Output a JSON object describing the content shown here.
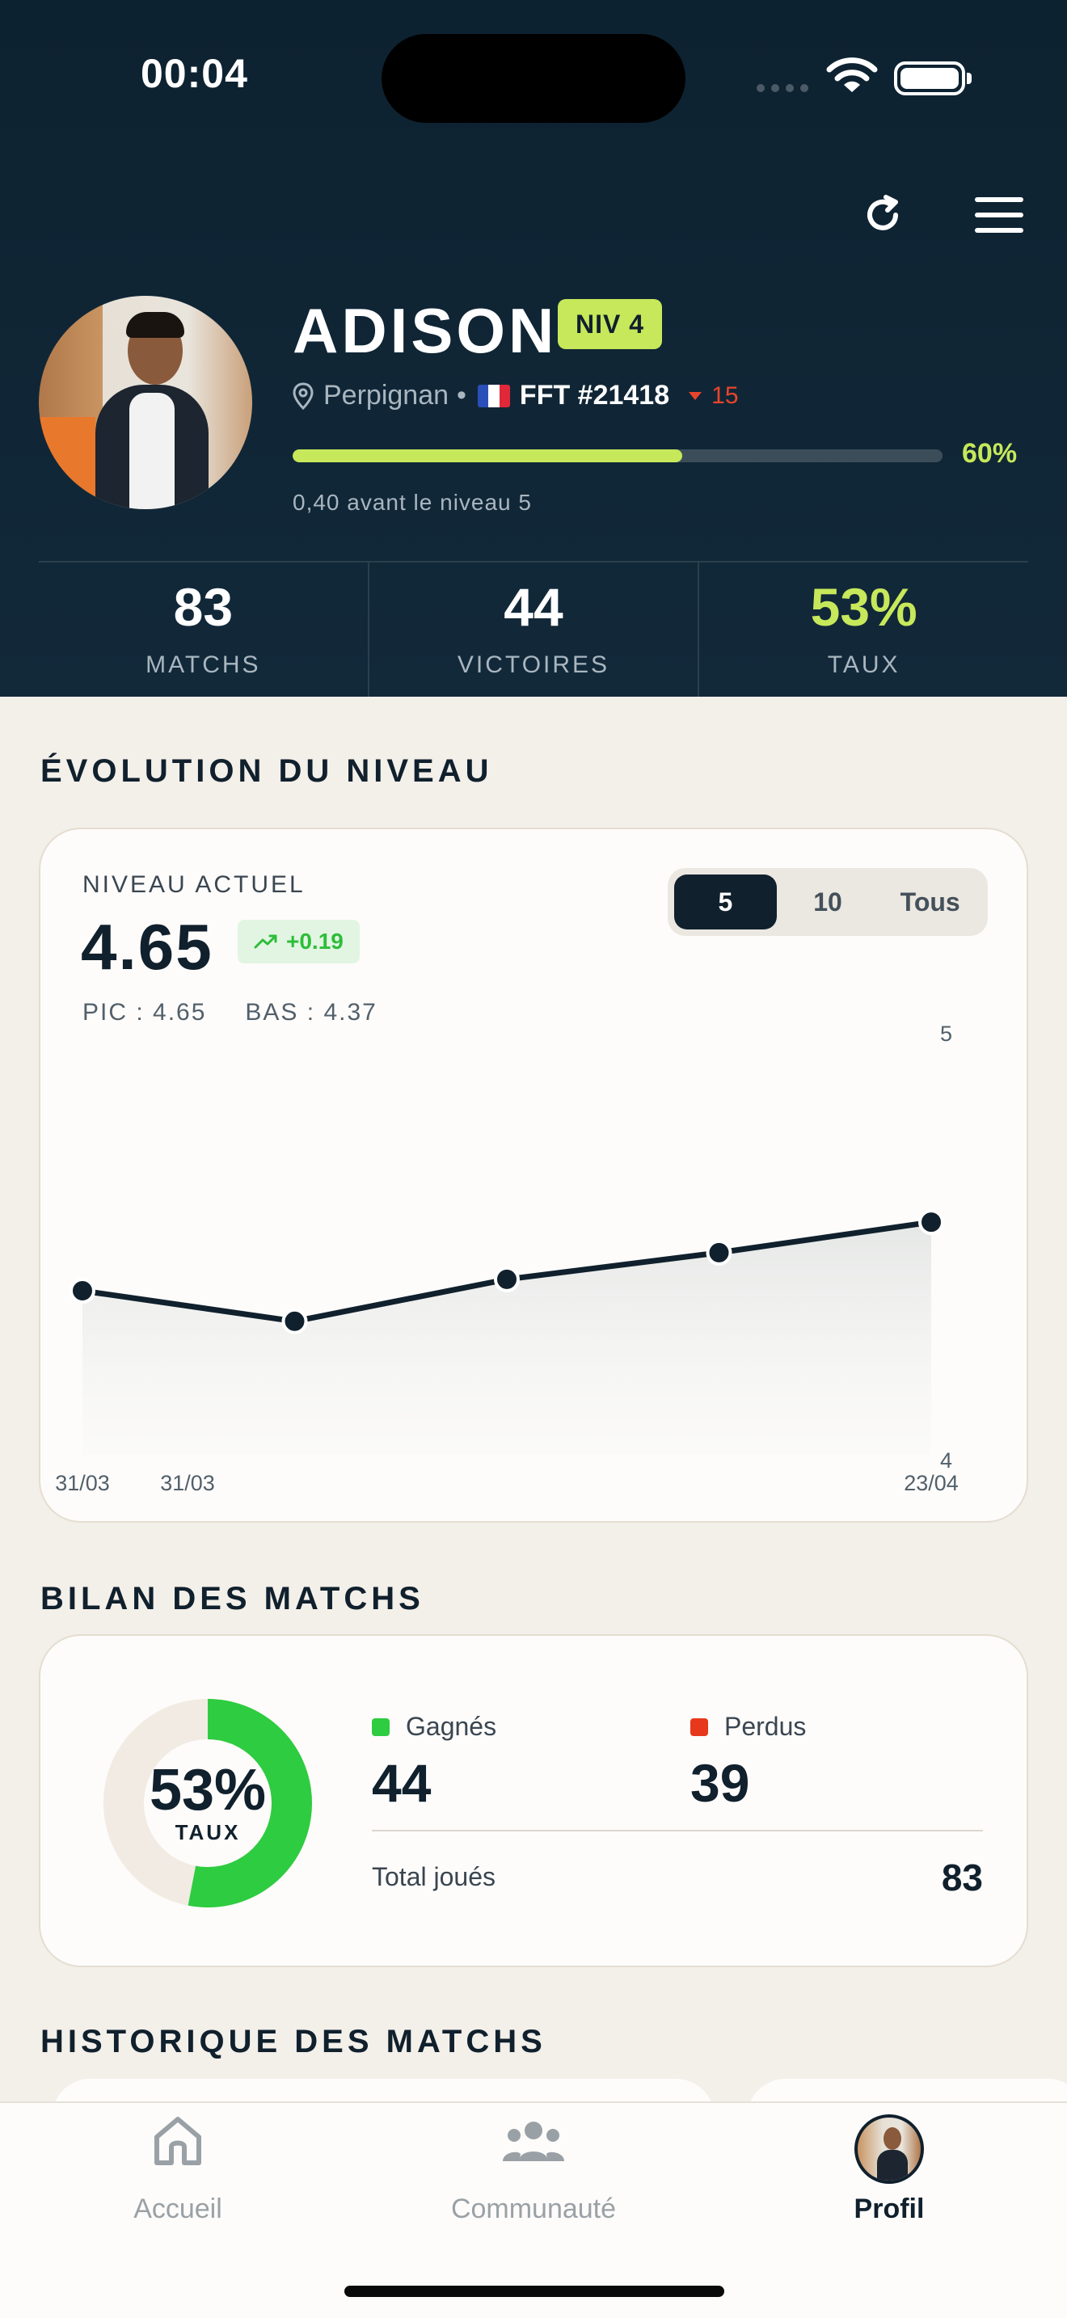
{
  "status_bar": {
    "time": "00:04"
  },
  "profile": {
    "name": "ADISON",
    "level_badge": "NIV 4",
    "city": "Perpignan",
    "separator": "•",
    "fft": "FFT #21418",
    "rank_change": "15",
    "progress_fraction": 0.6,
    "progress_pct_label": "60%",
    "progress_note": "0,40 avant le niveau 5"
  },
  "stats": [
    {
      "value": "83",
      "label": "MATCHS"
    },
    {
      "value": "44",
      "label": "VICTOIRES"
    },
    {
      "value": "53%",
      "label": "TAUX"
    }
  ],
  "evolution": {
    "section_title": "ÉVOLUTION DU NIVEAU",
    "current_label": "NIVEAU ACTUEL",
    "current_value": "4.65",
    "delta": "+0.19",
    "peak": "PIC : 4.65",
    "low": "BAS : 4.37",
    "segments": [
      "5",
      "10",
      "Tous"
    ],
    "active_segment": "5"
  },
  "chart_data": {
    "type": "line",
    "x": [
      "31/03",
      "31/03",
      "",
      "",
      "23/04"
    ],
    "y": [
      4.43,
      4.35,
      4.46,
      4.53,
      4.61
    ],
    "x_tick_labels": [
      "31/03",
      "31/03",
      "23/04"
    ],
    "ylim": [
      4,
      5
    ],
    "y_tick_labels": [
      "5",
      "4"
    ],
    "line_color": "#10202d",
    "area": true
  },
  "bilan": {
    "section_title": "BILAN DES MATCHS",
    "rate": "53%",
    "rate_label": "TAUX",
    "won_fraction": 0.53,
    "won_label": "Gagnés",
    "won_value": "44",
    "lost_label": "Perdus",
    "lost_value": "39",
    "total_label": "Total joués",
    "total_value": "83",
    "won_color": "#2ecc40",
    "lost_color": "#e8381c"
  },
  "history": {
    "section_title": "HISTORIQUE DES MATCHS"
  },
  "tabbar": {
    "items": [
      {
        "label": "Accueil",
        "icon": "home-icon"
      },
      {
        "label": "Communauté",
        "icon": "community-icon"
      },
      {
        "label": "Profil",
        "icon": "avatar"
      }
    ],
    "active": "Profil"
  },
  "colors": {
    "accent": "#c6e85a",
    "dark": "#10202d",
    "down": "#e8452c"
  }
}
